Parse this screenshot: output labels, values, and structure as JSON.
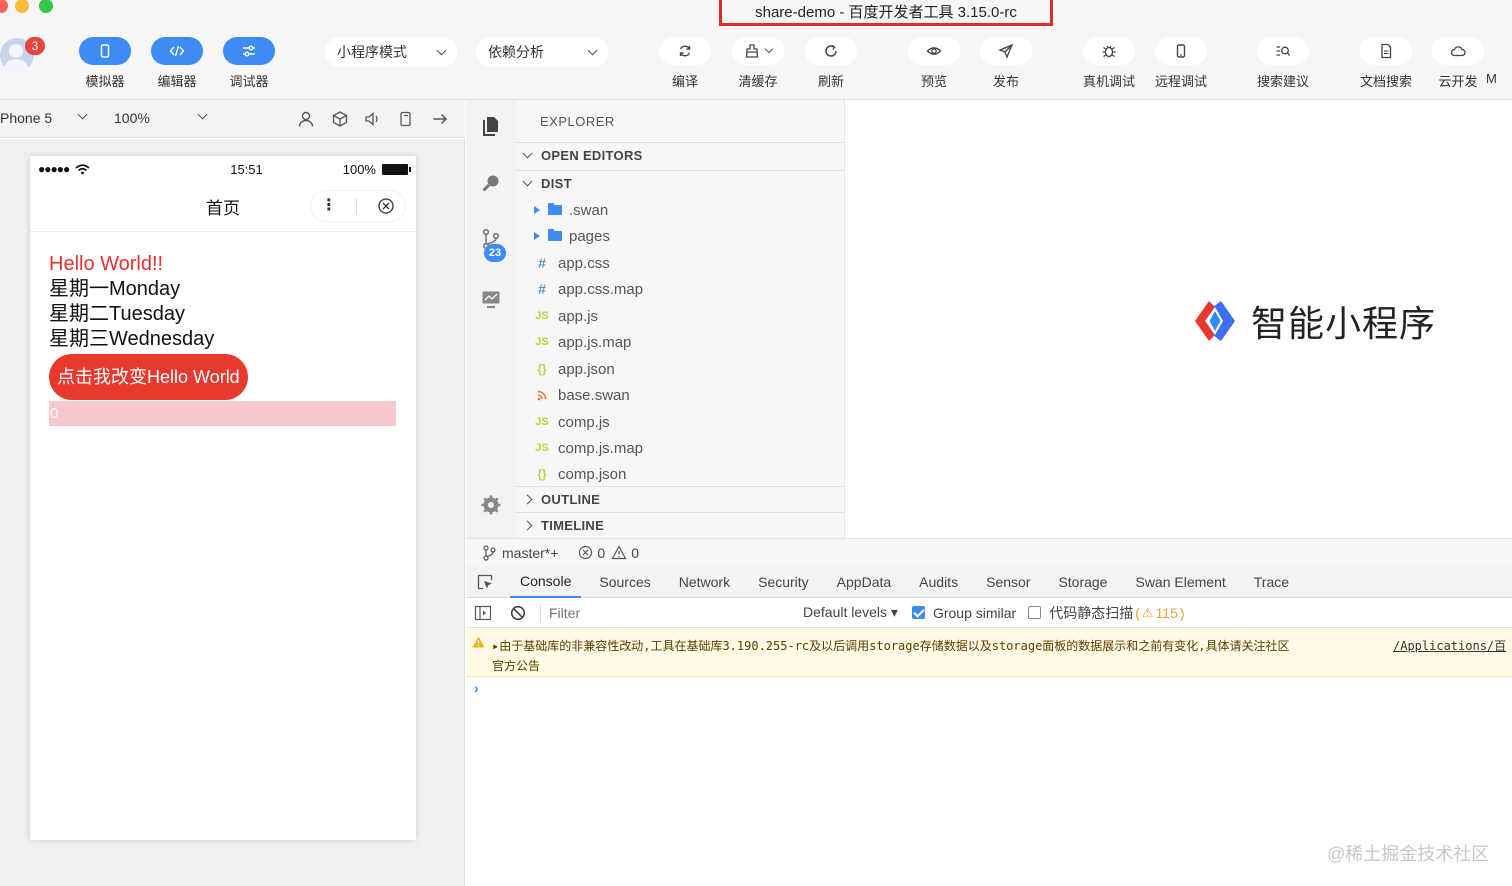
{
  "window": {
    "title": "share-demo - 百度开发者工具 3.15.0-rc"
  },
  "user": {
    "badge": "3"
  },
  "toolbar": {
    "mode_buttons": [
      {
        "label": "模拟器"
      },
      {
        "label": "编辑器"
      },
      {
        "label": "调试器"
      }
    ],
    "mode_select": "小程序模式",
    "dep_select": "依赖分析",
    "actions": [
      {
        "label": "编译"
      },
      {
        "label": "清缓存"
      },
      {
        "label": "刷新"
      },
      {
        "label": "预览"
      },
      {
        "label": "发布"
      },
      {
        "label": "真机调试"
      },
      {
        "label": "远程调试"
      },
      {
        "label": "搜索建议"
      },
      {
        "label": "文档搜索"
      },
      {
        "label": "云开发"
      },
      {
        "label": "M"
      }
    ]
  },
  "simulator": {
    "device": "Phone 5",
    "zoom": "100%",
    "status_time": "15:51",
    "status_battery": "100%",
    "status_signal": "●●●●●",
    "page_title": "首页",
    "lines": [
      "Hello World!!",
      "星期一Monday",
      "星期二Tuesday",
      "星期三Wednesday"
    ],
    "button_label": "点击我改变Hello World",
    "counter_value": "0"
  },
  "activity": {
    "scm_badge": "23"
  },
  "explorer": {
    "title": "EXPLORER",
    "open_editors": "OPEN EDITORS",
    "dist": "DIST",
    "outline": "OUTLINE",
    "timeline": "TIMELINE",
    "folders": [
      ".swan",
      "pages"
    ],
    "files": [
      {
        "name": "app.css",
        "icon": "#"
      },
      {
        "name": "app.css.map",
        "icon": "#"
      },
      {
        "name": "app.js",
        "icon": "JS"
      },
      {
        "name": "app.js.map",
        "icon": "JS"
      },
      {
        "name": "app.json",
        "icon": "{}"
      },
      {
        "name": "base.swan",
        "icon": "rss"
      },
      {
        "name": "comp.js",
        "icon": "JS"
      },
      {
        "name": "comp.js.map",
        "icon": "JS"
      },
      {
        "name": "comp.json",
        "icon": "{}"
      }
    ]
  },
  "editor": {
    "logo_text": "智能小程序"
  },
  "statusbar": {
    "branch": "master*+",
    "errors": "0",
    "warnings": "0"
  },
  "devtools": {
    "tabs": [
      "Console",
      "Sources",
      "Network",
      "Security",
      "AppData",
      "Audits",
      "Sensor",
      "Storage",
      "Swan Element",
      "Trace"
    ],
    "filter_placeholder": "Filter",
    "levels": "Default levels ▾",
    "group_similar": "Group similar",
    "static_scan": "代码静态扫描",
    "scan_count_open": "(",
    "scan_count": "115",
    "scan_count_close": ")",
    "warning_text": "▸由于基础库的非兼容性改动,工具在基础库3.190.255-rc及以后调用storage存储数据以及storage面板的数据展示和之前有变化,具体请关注社区",
    "warning_text2": "官方公告",
    "warning_link": "/Applications/百"
  },
  "watermark": "@稀土掘金技术社区"
}
